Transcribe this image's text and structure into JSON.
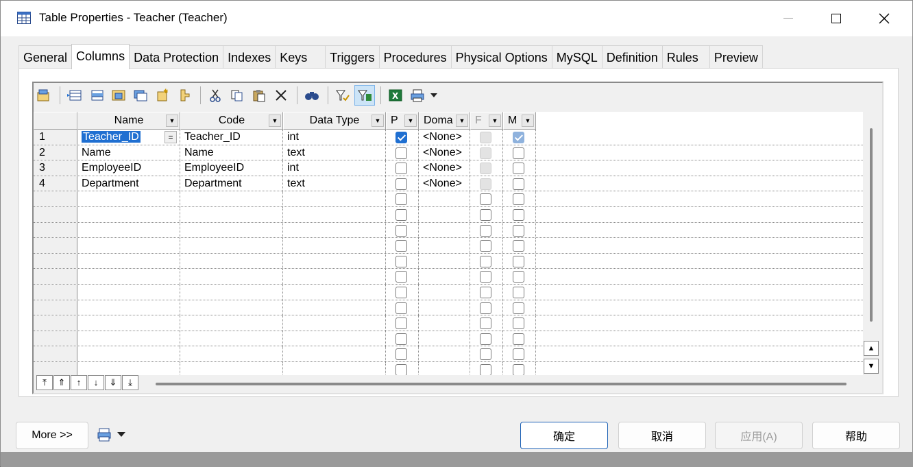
{
  "window": {
    "title": "Table Properties - Teacher (Teacher)"
  },
  "tabs": [
    "General",
    "Columns",
    "Data Protection",
    "Indexes",
    "Keys",
    "Triggers",
    "Procedures",
    "Physical Options",
    "MySQL",
    "Definition",
    "Rules",
    "Preview"
  ],
  "active_tab": "Columns",
  "toolbar": {
    "icons": [
      "properties-icon",
      "add-row-icon",
      "insert-row-icon",
      "add-columns-icon",
      "replicate-icon",
      "new-icon",
      "wizard-icon",
      "cut-icon",
      "copy-icon",
      "paste-icon",
      "delete-icon",
      "find-icon",
      "filter-icon",
      "enable-filter-icon",
      "excel-export-icon",
      "print-icon",
      "dropdown-arrow-icon"
    ]
  },
  "grid": {
    "headers": [
      "Name",
      "Code",
      "Data Type",
      "P",
      "Doma",
      "F",
      "M"
    ],
    "rows": [
      {
        "num": "1",
        "name": "Teacher_ID",
        "code": "Teacher_ID",
        "type": "int",
        "p": true,
        "domain": "<None>",
        "f": false,
        "m": true
      },
      {
        "num": "2",
        "name": "Name",
        "code": "Name",
        "type": "text",
        "p": false,
        "domain": "<None>",
        "f": false,
        "m": false
      },
      {
        "num": "3",
        "name": "EmployeeID",
        "code": "EmployeeID",
        "type": "int",
        "p": false,
        "domain": "<None>",
        "f": false,
        "m": false
      },
      {
        "num": "4",
        "name": "Department",
        "code": "Department",
        "type": "text",
        "p": false,
        "domain": "<None>",
        "f": false,
        "m": false
      }
    ],
    "eq_label": "="
  },
  "buttons": {
    "more": "More >>",
    "ok": "确定",
    "cancel": "取消",
    "apply": "应用(A)",
    "help": "帮助"
  }
}
